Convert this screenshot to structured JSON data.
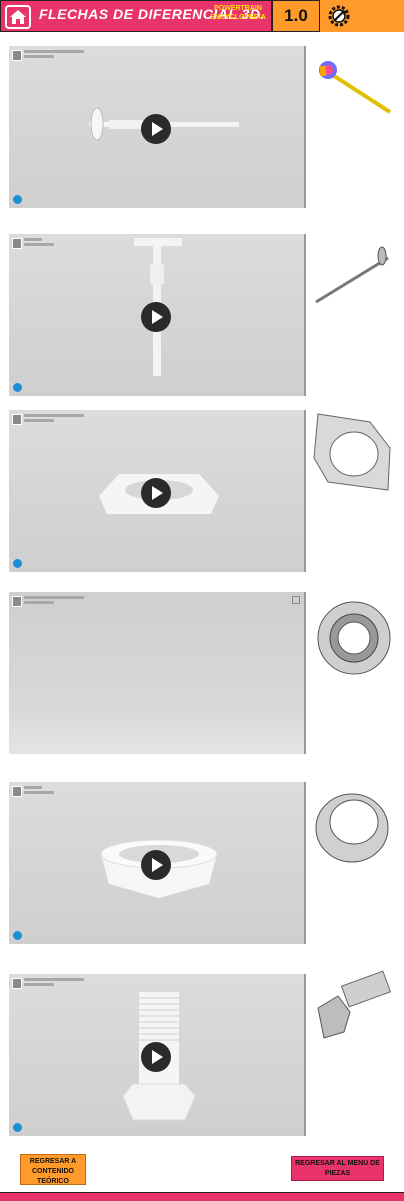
{
  "header": {
    "title": "FLECHAS DE DIFERENCIAL 3D.",
    "brand": "POWERTRAIN ENCYCLOPEDIA",
    "version": "1.0",
    "home_icon": "home-icon",
    "gear_icon": "gear-wrench-icon"
  },
  "viewers": [
    {
      "part": "axle-shaft-with-flange"
    },
    {
      "part": "shaft-vertical"
    },
    {
      "part": "flange-plate"
    },
    {
      "part": "bearing-loading"
    },
    {
      "part": "ring-collar"
    },
    {
      "part": "bolt"
    }
  ],
  "buttons": {
    "back_label": "REGRESAR A CONTENIDO TEÓRICO",
    "menu_label": "REGRESAR AL MENU DE PIEZAS"
  },
  "colors": {
    "header_pink": "#e8336b",
    "header_orange": "#ff9a2b",
    "brand_yellow": "#ffe400"
  }
}
